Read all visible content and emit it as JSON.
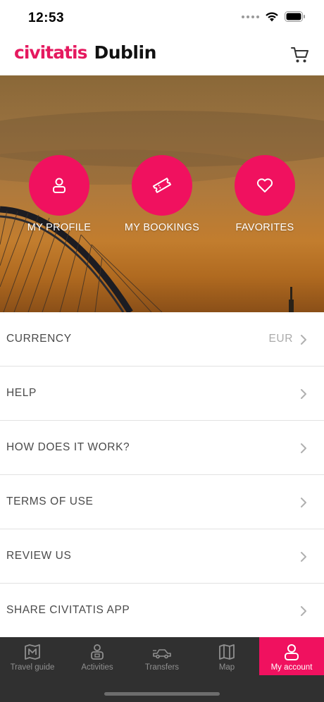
{
  "status_bar": {
    "time": "12:53"
  },
  "header": {
    "brand": "civitatis",
    "city": "Dublin"
  },
  "hero": {
    "actions": [
      {
        "label": "MY PROFILE",
        "icon": "user-icon"
      },
      {
        "label": "MY BOOKINGS",
        "icon": "ticket-icon"
      },
      {
        "label": "FAVORITES",
        "icon": "heart-icon"
      }
    ]
  },
  "menu": {
    "items": [
      {
        "label": "CURRENCY",
        "value": "EUR"
      },
      {
        "label": "HELP"
      },
      {
        "label": "HOW DOES IT WORK?"
      },
      {
        "label": "TERMS OF USE"
      },
      {
        "label": "REVIEW US"
      },
      {
        "label": "SHARE CIVITATIS APP"
      }
    ]
  },
  "tab_bar": {
    "tabs": [
      {
        "label": "Travel guide",
        "icon": "guide-map-icon"
      },
      {
        "label": "Activities",
        "icon": "activities-icon"
      },
      {
        "label": "Transfers",
        "icon": "car-icon"
      },
      {
        "label": "Map",
        "icon": "map-icon"
      },
      {
        "label": "My account",
        "icon": "user-icon",
        "active": true
      }
    ]
  },
  "colors": {
    "brand": "#e5195f",
    "hero_button": "#f0115f",
    "tab_bar_bg": "#303030",
    "tab_active_bg": "#f0115f"
  }
}
